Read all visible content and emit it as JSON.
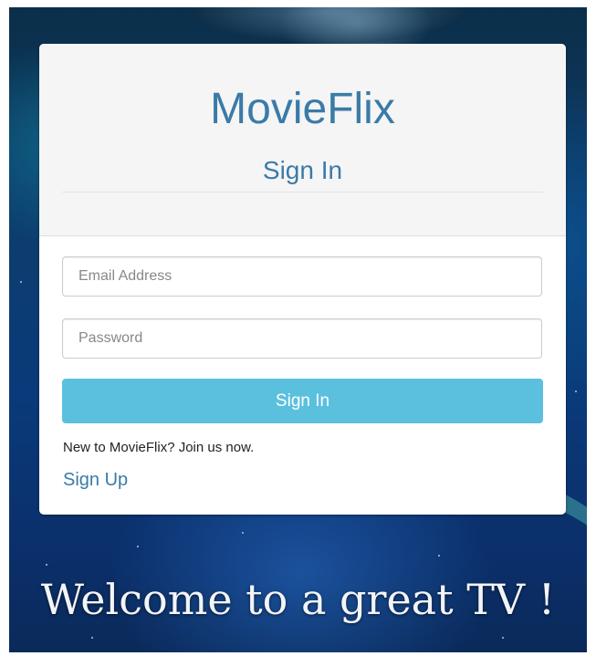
{
  "app": {
    "title": "MovieFlix"
  },
  "header": {
    "subtitle": "Sign In"
  },
  "form": {
    "email": {
      "placeholder": "Email Address",
      "value": ""
    },
    "password": {
      "placeholder": "Password",
      "value": ""
    },
    "submit_label": "Sign In"
  },
  "signup": {
    "prompt": "New to MovieFlix? Join us now.",
    "link_label": "Sign Up"
  },
  "banner": {
    "welcome": "Welcome to a great TV !"
  },
  "colors": {
    "brand_text": "#3a7ba8",
    "button_bg": "#5bc0de",
    "header_bg": "#f5f5f5"
  }
}
